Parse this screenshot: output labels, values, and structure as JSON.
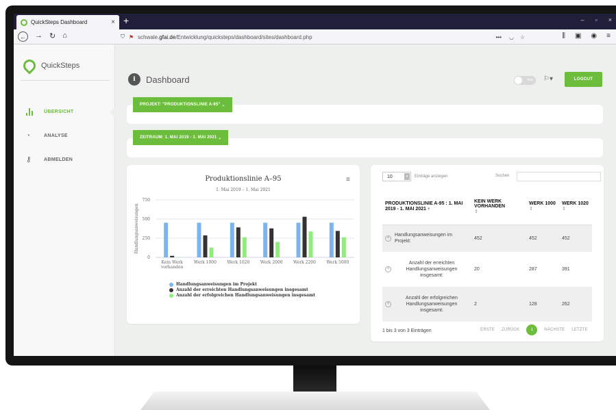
{
  "browser": {
    "tab_title": "QuickSteps Dashboard",
    "tab_close": "×",
    "new_tab": "+",
    "window_controls": [
      "–",
      "▫",
      "×"
    ],
    "url_prefix": "schwale.",
    "url_domain": "gfai.de",
    "url_path": "/Entwicklung/quicksteps/dashboard/sites/dashboard.php",
    "url_menu": "•••"
  },
  "sidebar": {
    "brand": "QuickSteps",
    "items": [
      {
        "label": "ÜBERSICHT"
      },
      {
        "label": "ANALYSE"
      },
      {
        "label": "ABMELDEN"
      }
    ]
  },
  "header": {
    "title": "Dashboard",
    "info_glyph": "i",
    "toggle_label": "Aus",
    "logout": "LOGOUT"
  },
  "filters": {
    "project": "PROJEKT: \"PRODUKTIONSLINIE A-95\"",
    "period": "ZEITRAUM: 1. MAI 2019 - 1. MAI 2021"
  },
  "chart_data": {
    "type": "bar",
    "title": "Produktionslinie A–95",
    "subtitle": "1. Mai 2019 – 1. Mai 2021",
    "ylabel": "Handlungsanweisungen",
    "ylim": [
      0,
      750
    ],
    "yticks": [
      0,
      250,
      500,
      750
    ],
    "categories": [
      "Kein Werk vorhanden",
      "Werk 1000",
      "Werk 1020",
      "Werk 2000",
      "Werk 2200",
      "Werk 5000"
    ],
    "category_lines": [
      [
        "Kein Werk",
        "vorhanden"
      ],
      [
        "Werk 1000"
      ],
      [
        "Werk 1020"
      ],
      [
        "Werk 2000"
      ],
      [
        "Werk 2200"
      ],
      [
        "Werk 5000"
      ]
    ],
    "series": [
      {
        "name": "Handlungsanweisungen im Projekt",
        "color": "#7cb5ec",
        "values": [
          452,
          452,
          452,
          452,
          452,
          452
        ]
      },
      {
        "name": "Anzahl der erreichten Handlungsanweisungen insgesamt",
        "color": "#333333",
        "values": [
          20,
          287,
          391,
          378,
          530,
          345
        ]
      },
      {
        "name": "Anzahl der erfolgreichen Handlungsanweisungen insgesamt",
        "color": "#90ed7d",
        "values": [
          2,
          128,
          262,
          200,
          338,
          262
        ]
      }
    ],
    "grid": true,
    "legend": "bottom"
  },
  "table": {
    "length_value": "10",
    "length_label": "Einträge anzeigen",
    "search_label": "Suchen",
    "headers": [
      "PRODUKTIONSLINIE A-95 : 1. MAI 2019 - 1. MAI 2021",
      "KEIN WERK VORHANDEN",
      "WERK 1000",
      "WERK 1020"
    ],
    "rows": [
      {
        "label": "Handlungsanweisungen im Projekt:",
        "values": [
          "452",
          "452",
          "452"
        ]
      },
      {
        "label": "Anzahl der erreichten Handlungsanweisungen insgesamt:",
        "values": [
          "20",
          "287",
          "391"
        ]
      },
      {
        "label": "Anzahl der erfolgreichen Handlungsanweisungen insgesamt:",
        "values": [
          "2",
          "128",
          "262"
        ]
      }
    ],
    "info": "1 bis 3 von 3 Einträgen",
    "pager": {
      "first": "ERSTE",
      "prev": "ZURÜCK",
      "current": "1",
      "next": "NÄCHSTE",
      "last": "LETZTE"
    }
  },
  "colors": {
    "accent": "#6cbd3b",
    "page_bg": "#eef0ee"
  }
}
